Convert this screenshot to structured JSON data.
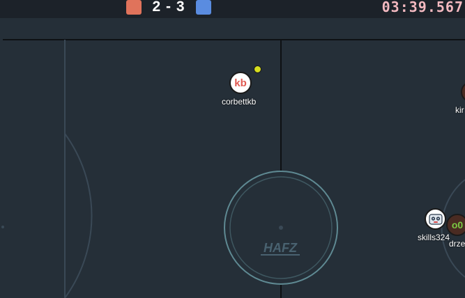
{
  "scoreboard": {
    "red_color": "#e0735b",
    "blue_color": "#5a8ce0",
    "score_text": "2 - 3",
    "clock_text": "03:39.567"
  },
  "colors": {
    "field_bg": "#252f38",
    "line_dark": "#0e1114",
    "line_faint": "#3a4956",
    "center_ring": "#5f8a93",
    "ball": "#d6de1f"
  },
  "center_logo_text": "HAFZ",
  "players": [
    {
      "id": "corbettkb",
      "name": "corbettkb",
      "avatar_text": "kb",
      "avatar_color": "#e05a52",
      "team": "red"
    },
    {
      "id": "skills324",
      "name": "skills324",
      "avatar_text": "",
      "avatar_icon": "robot-face-icon",
      "team": "red"
    },
    {
      "id": "drze",
      "name": "drze",
      "avatar_text": "o0",
      "avatar_color": "#7ac943",
      "team": "blue"
    },
    {
      "id": "kir",
      "name": "kir",
      "avatar_text": "",
      "team": "blue"
    }
  ]
}
